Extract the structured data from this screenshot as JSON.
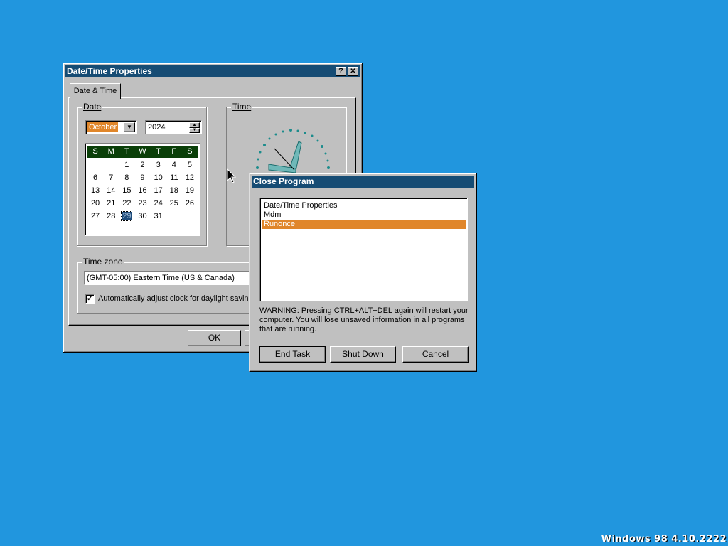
{
  "datetime_dialog": {
    "title": "Date/Time Properties",
    "help_button": "?",
    "close_button": "✕",
    "tab": "Date & Time",
    "date_group": {
      "label": "Date",
      "month": "October",
      "year": "2024"
    },
    "calendar": {
      "weekdays": [
        "S",
        "M",
        "T",
        "W",
        "T",
        "F",
        "S"
      ],
      "weeks": [
        [
          "",
          "",
          "1",
          "2",
          "3",
          "4",
          "5"
        ],
        [
          "6",
          "7",
          "8",
          "9",
          "10",
          "11",
          "12"
        ],
        [
          "13",
          "14",
          "15",
          "16",
          "17",
          "18",
          "19"
        ],
        [
          "20",
          "21",
          "22",
          "23",
          "24",
          "25",
          "26"
        ],
        [
          "27",
          "28",
          "29",
          "30",
          "31",
          "",
          ""
        ]
      ],
      "selected_day": "29"
    },
    "time_group": {
      "label": "Time"
    },
    "timezone_group": {
      "label": "Time zone",
      "value": "(GMT-05:00) Eastern Time (US & Canada)",
      "dst_checkbox_label": "Automatically adjust clock for daylight saving c",
      "dst_checked": true
    },
    "ok_button": "OK"
  },
  "close_program": {
    "title": "Close Program",
    "tasks": [
      "Date/Time Properties",
      "Mdm",
      "Runonce"
    ],
    "selected_task": "Runonce",
    "warning": "WARNING: Pressing CTRL+ALT+DEL again will restart your computer. You will lose unsaved information in all programs that are running.",
    "buttons": {
      "end_task": "End Task",
      "shut_down": "Shut Down",
      "cancel": "Cancel"
    }
  },
  "desktop": {
    "version_watermark": "Windows 98 4.10.2222",
    "background_color": "#2196DE",
    "accent_color": "#164C74",
    "selection_color": "#E0862A"
  }
}
